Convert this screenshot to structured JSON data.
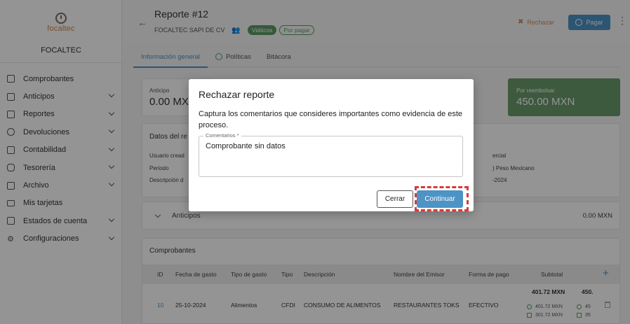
{
  "sidebar": {
    "logo_text": "focaltec",
    "company": "FOCALTEC",
    "items": [
      {
        "label": "Comprobantes",
        "icon": "receipt-icon",
        "chevron": false
      },
      {
        "label": "Anticipos",
        "icon": "money-icon",
        "chevron": true
      },
      {
        "label": "Reportes",
        "icon": "report-icon",
        "chevron": true
      },
      {
        "label": "Devoluciones",
        "icon": "return-icon",
        "chevron": true
      },
      {
        "label": "Contabilidad",
        "icon": "bank-icon",
        "chevron": true
      },
      {
        "label": "Tesorería",
        "icon": "piggy-bank-icon",
        "chevron": true
      },
      {
        "label": "Archivo",
        "icon": "archive-icon",
        "chevron": true
      },
      {
        "label": "Mis tarjetas",
        "icon": "credit-card-icon",
        "chevron": false
      },
      {
        "label": "Estados de cuenta",
        "icon": "statement-icon",
        "chevron": true
      },
      {
        "label": "Configuraciones",
        "icon": "gear-icon",
        "chevron": true
      }
    ]
  },
  "header": {
    "title": "Reporte #12",
    "company": "FOCALTEC SAPI DE CV",
    "badge_type": "Viáticos",
    "badge_status": "Por pagar",
    "reject_label": "Rechazar",
    "pay_label": "Pagar"
  },
  "tabs": [
    "Información general",
    "Políticas",
    "Bitácora"
  ],
  "summary": {
    "anticipo_label": "Anticipo",
    "anticipo_value": "0.00 MX",
    "reembolso_label": "Por reembolsar",
    "reembolso_value": "450.00 MXN"
  },
  "datos": {
    "title": "Datos del re",
    "rows": [
      {
        "left": "Usuario cread",
        "right": "ercial"
      },
      {
        "left": "Periodo",
        "right": ") Peso Mexicano"
      },
      {
        "left": "Descripción d",
        "right": "-2024"
      }
    ]
  },
  "anticipos": {
    "label": "Anticipos",
    "value": "0.00 MXN"
  },
  "comprobantes": {
    "title": "Comprobantes",
    "columns": [
      "ID",
      "Fecha de gasto",
      "Tipo de gasto",
      "Tipo",
      "Descripción",
      "Nombre del Emisor",
      "Forma de pago",
      "Subtotal"
    ],
    "row": {
      "id": "10",
      "fecha": "25-10-2024",
      "tipo_gasto": "Alimentos",
      "tipo": "CFDI",
      "descripcion": "CONSUMO DE ALIMENTOS",
      "emisor": "RESTAURANTES TOKS",
      "forma_pago": "EFECTIVO",
      "subtotal": "401.72 MXN",
      "subtotal_a": "401.72 MXN",
      "subtotal_b": "301.72 MXN",
      "total": "450.",
      "total_a": "45",
      "total_b": "35"
    }
  },
  "modal": {
    "title": "Rechazar reporte",
    "description": "Captura los comentarios que consideres importantes como evidencia de este proceso.",
    "field_label": "Comentarios *",
    "field_value": "Comprobante sin datos",
    "cancel_label": "Cerrar",
    "confirm_label": "Continuar"
  },
  "colors": {
    "accent": "#4d93c5",
    "success": "#5c9a63",
    "reject": "#d58a5a",
    "highlight": "#d73a3a"
  }
}
